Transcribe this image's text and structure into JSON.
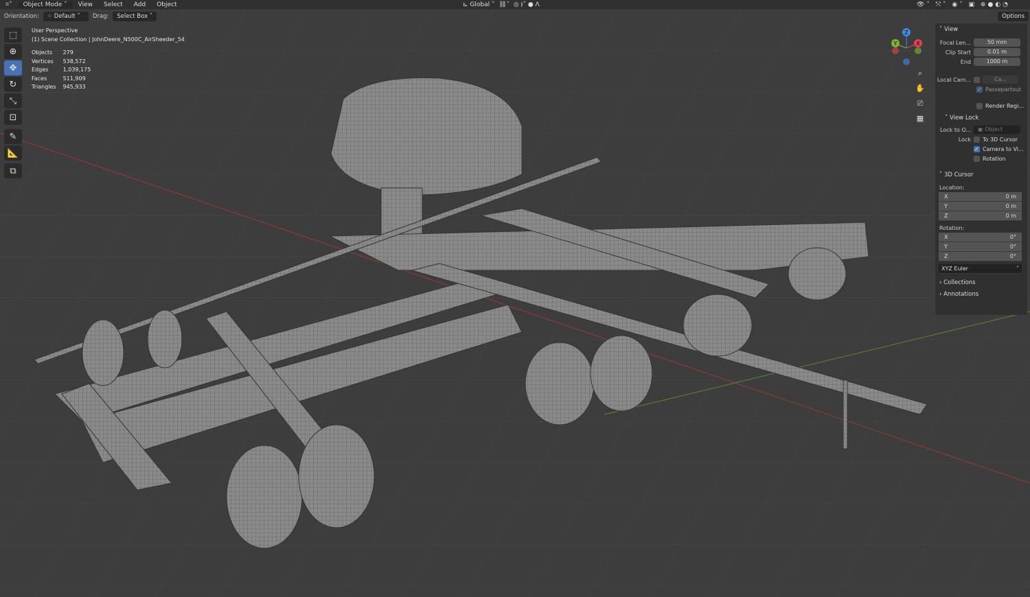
{
  "header": {
    "editor_icon": "editor-type-icon",
    "mode": "Object Mode",
    "menus": [
      "View",
      "Select",
      "Add",
      "Object"
    ],
    "orientation_label": "Orientation:",
    "orientation": "Default",
    "drag_label": "Drag:",
    "drag": "Select Box",
    "transform": "Global",
    "options": "Options"
  },
  "overlay": {
    "perspective": "User Perspective",
    "collection": "(1) Scene Collection | JohnDeere_N500C_AirSheeder_54",
    "stats": [
      {
        "k": "Objects",
        "v": "279"
      },
      {
        "k": "Vertices",
        "v": "538,572"
      },
      {
        "k": "Edges",
        "v": "1,039,175"
      },
      {
        "k": "Faces",
        "v": "511,909"
      },
      {
        "k": "Triangles",
        "v": "945,933"
      }
    ]
  },
  "gizmo": {
    "x": "X",
    "y": "Y",
    "z": "Z",
    "colors": {
      "x": "#e5404d",
      "y": "#7fb234",
      "z": "#3f8be1"
    }
  },
  "panel": {
    "view": "View",
    "focal_label": "Focal Len...",
    "focal": "50 mm",
    "clip_start_label": "Clip Start",
    "clip_start": "0.01 m",
    "end_label": "End",
    "end": "1000 m",
    "local_cam_label": "Local Cam...",
    "local_cam": "Ca...",
    "passepartout": "Passepartout",
    "render_region": "Render Regi...",
    "view_lock": "View Lock",
    "lock_to_label": "Lock to O...",
    "lock_to": "Object",
    "lock_label": "Lock",
    "to_cursor": "To 3D Cursor",
    "camera_to_view": "Camera to Vi...",
    "rotation_lock": "Rotation",
    "cursor": "3D Cursor",
    "location_label": "Location:",
    "loc": [
      {
        "a": "X",
        "v": "0 m"
      },
      {
        "a": "Y",
        "v": "0 m"
      },
      {
        "a": "Z",
        "v": "0 m"
      }
    ],
    "rotation_label": "Rotation:",
    "rot": [
      {
        "a": "X",
        "v": "0°"
      },
      {
        "a": "Y",
        "v": "0°"
      },
      {
        "a": "Z",
        "v": "0°"
      }
    ],
    "rotation_mode": "XYZ Euler",
    "collections": "Collections",
    "annotations": "Annotations"
  },
  "colors": {
    "accent": "#4772b3",
    "x_axis": "#8a3a3a",
    "y_axis": "#5a7a2a"
  }
}
